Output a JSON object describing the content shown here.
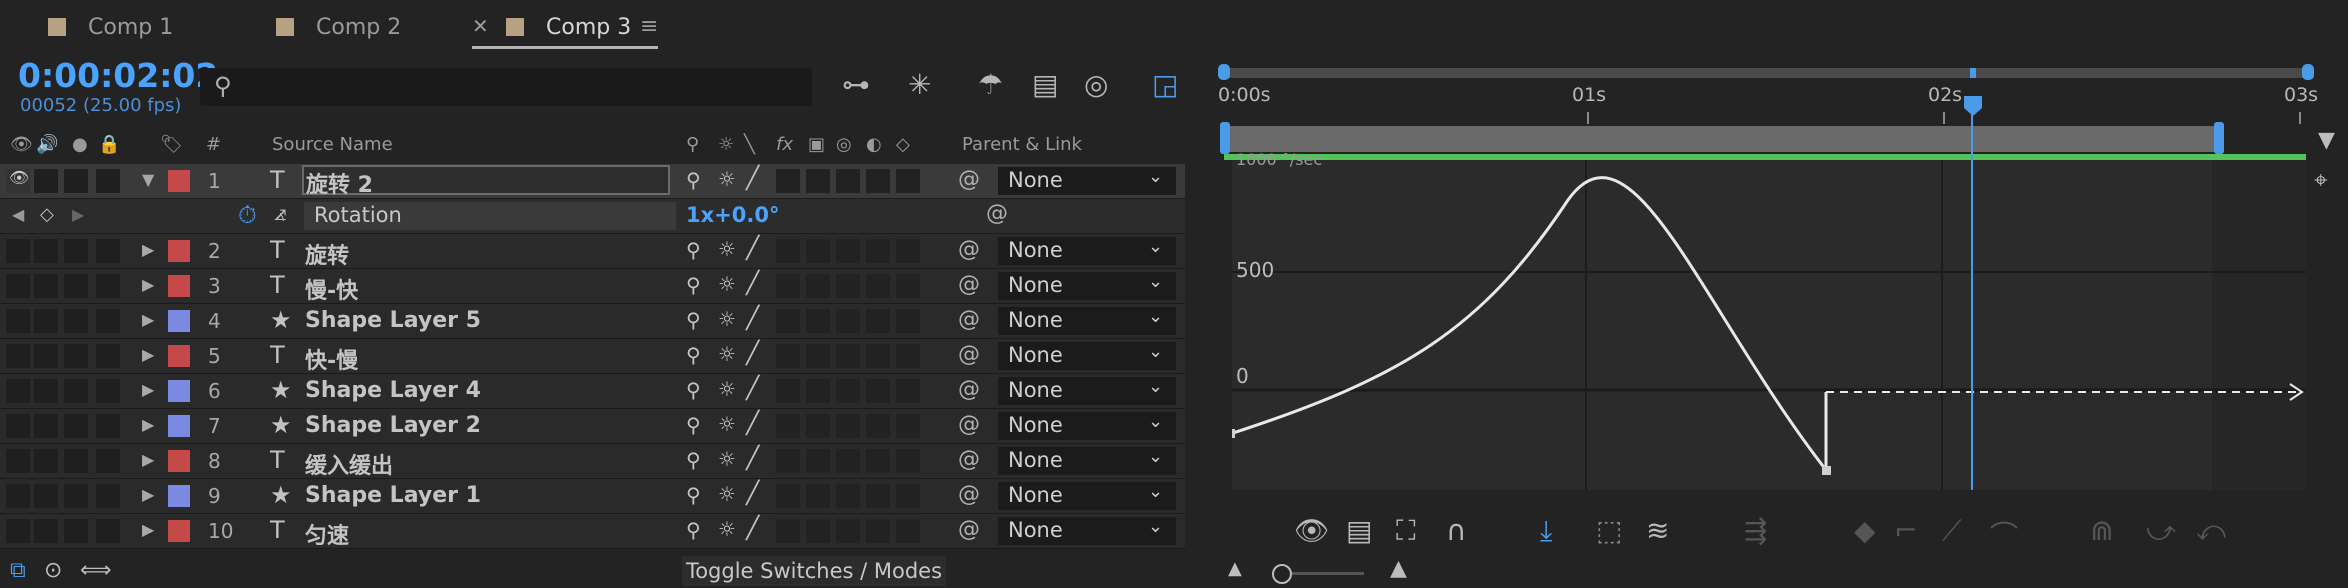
{
  "tabs": [
    {
      "label": "Comp 1",
      "color": "#b6a282"
    },
    {
      "label": "Comp 2",
      "color": "#b6a282"
    },
    {
      "label": "Comp 3",
      "color": "#b6a282",
      "active": true
    }
  ],
  "timecode": "0:00:02:02",
  "frame_info": "00052 (25.00 fps)",
  "search": {
    "placeholder": ""
  },
  "columns": {
    "source_name": "Source Name",
    "number": "#",
    "parent_link": "Parent & Link",
    "switch_fx": "fx"
  },
  "layers": [
    {
      "num": "1",
      "type": "T",
      "name": "旋转 2",
      "label_color": "#c44a4a",
      "parent": "None",
      "expanded": true,
      "selected": true
    },
    {
      "num": "2",
      "type": "T",
      "name": "旋转",
      "label_color": "#c44a4a",
      "parent": "None"
    },
    {
      "num": "3",
      "type": "T",
      "name": "慢-快",
      "label_color": "#c44a4a",
      "parent": "None"
    },
    {
      "num": "4",
      "type": "★",
      "name": "Shape Layer 5",
      "label_color": "#7a8ae0",
      "parent": "None"
    },
    {
      "num": "5",
      "type": "T",
      "name": "快-慢",
      "label_color": "#c44a4a",
      "parent": "None"
    },
    {
      "num": "6",
      "type": "★",
      "name": "Shape Layer 4",
      "label_color": "#7a8ae0",
      "parent": "None"
    },
    {
      "num": "7",
      "type": "★",
      "name": "Shape Layer 2",
      "label_color": "#7a8ae0",
      "parent": "None"
    },
    {
      "num": "8",
      "type": "T",
      "name": "缓入缓出",
      "label_color": "#c44a4a",
      "parent": "None"
    },
    {
      "num": "9",
      "type": "★",
      "name": "Shape Layer 1",
      "label_color": "#7a8ae0",
      "parent": "None"
    },
    {
      "num": "10",
      "type": "T",
      "name": "匀速",
      "label_color": "#c44a4a",
      "parent": "None"
    }
  ],
  "property": {
    "name": "Rotation",
    "value": "1x+0.0°"
  },
  "bottom": {
    "toggle_label": "Toggle Switches / Modes"
  },
  "graph": {
    "ruler_labels": [
      "0:00s",
      "01s",
      "02s",
      "03s"
    ],
    "y_labels": {
      "top": "1000 °/sec",
      "mid": "500",
      "zero": "0"
    }
  },
  "colors": {
    "accent": "#4a9bea",
    "timecode": "#4aa3ff",
    "green_bar": "#53c45a"
  }
}
